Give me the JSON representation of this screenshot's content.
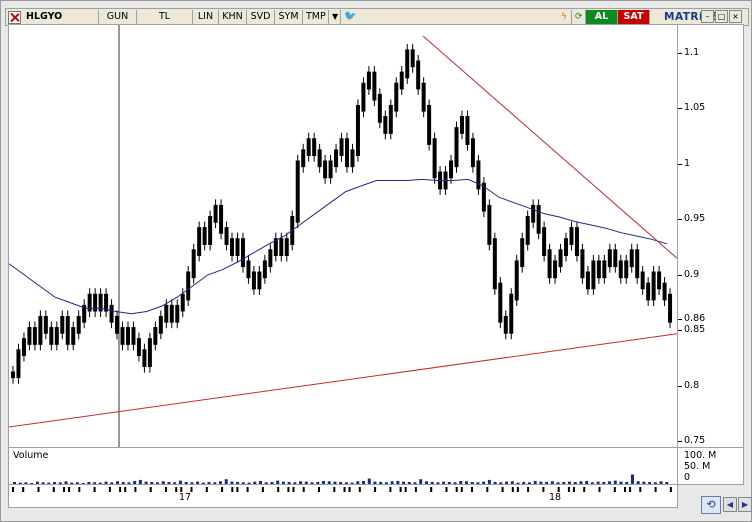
{
  "toolbar": {
    "symbol": "HLGYO",
    "period": "GUN",
    "currency": "TL",
    "scale": "LIN",
    "buttons": [
      "KHN",
      "SVD",
      "SYM",
      "TMP"
    ],
    "buy_label": "AL",
    "sell_label": "SAT",
    "brand": "MATRiKS"
  },
  "volume_panel": {
    "title": "Volume",
    "labels": [
      "100. M",
      "50. M",
      "0"
    ]
  },
  "chart_data": {
    "type": "candlestick",
    "y_ticks": [
      "1.1",
      "1.05",
      "1",
      "0.95",
      "0.9",
      "0.86",
      "0.85",
      "0.8",
      "0.75"
    ],
    "ylim": [
      0.745,
      1.125
    ],
    "x_labels": [
      "17",
      "18"
    ],
    "series": [
      {
        "name": "price",
        "values": [
          0.81,
          0.83,
          0.84,
          0.85,
          0.84,
          0.86,
          0.85,
          0.84,
          0.85,
          0.86,
          0.84,
          0.85,
          0.86,
          0.87,
          0.88,
          0.87,
          0.88,
          0.87,
          0.86,
          0.85,
          0.84,
          0.85,
          0.84,
          0.83,
          0.82,
          0.84,
          0.85,
          0.86,
          0.87,
          0.86,
          0.87,
          0.88,
          0.9,
          0.92,
          0.94,
          0.93,
          0.95,
          0.96,
          0.94,
          0.93,
          0.92,
          0.93,
          0.91,
          0.9,
          0.89,
          0.9,
          0.91,
          0.92,
          0.93,
          0.92,
          0.93,
          0.95,
          1.0,
          1.01,
          1.02,
          1.01,
          1.0,
          0.99,
          1.0,
          1.01,
          1.02,
          1.0,
          1.01,
          1.05,
          1.07,
          1.08,
          1.06,
          1.04,
          1.03,
          1.05,
          1.07,
          1.08,
          1.1,
          1.09,
          1.07,
          1.05,
          1.02,
          0.99,
          0.98,
          0.99,
          1.0,
          1.03,
          1.04,
          1.02,
          1.0,
          0.98,
          0.96,
          0.93,
          0.89,
          0.86,
          0.85,
          0.88,
          0.91,
          0.93,
          0.95,
          0.96,
          0.94,
          0.92,
          0.9,
          0.91,
          0.92,
          0.93,
          0.94,
          0.92,
          0.9,
          0.89,
          0.91,
          0.9,
          0.91,
          0.92,
          0.91,
          0.9,
          0.91,
          0.92,
          0.9,
          0.89,
          0.88,
          0.9,
          0.89,
          0.88,
          0.86
        ]
      },
      {
        "name": "moving-average",
        "values": [
          0.91,
          0.9,
          0.89,
          0.88,
          0.875,
          0.87,
          0.87,
          0.867,
          0.865,
          0.867,
          0.872,
          0.88,
          0.89,
          0.9,
          0.905,
          0.912,
          0.92,
          0.928,
          0.935,
          0.945,
          0.955,
          0.965,
          0.975,
          0.98,
          0.985,
          0.985,
          0.985,
          0.986,
          0.985,
          0.985,
          0.986,
          0.98,
          0.97,
          0.965,
          0.96,
          0.955,
          0.952,
          0.948,
          0.945,
          0.942,
          0.938,
          0.935,
          0.932,
          0.928
        ]
      }
    ],
    "trendlines": [
      {
        "name": "support",
        "from": [
          0,
          0.763
        ],
        "to": [
          1,
          0.847
        ],
        "color": "#cc2a2a"
      },
      {
        "name": "resistance",
        "from": [
          0.62,
          1.115
        ],
        "to": [
          1,
          0.915
        ],
        "color": "#cc2a2a"
      }
    ],
    "volume": [
      6,
      4,
      5,
      3,
      7,
      5,
      4,
      6,
      5,
      8,
      4,
      5,
      3,
      6,
      5,
      4,
      7,
      5,
      8,
      6,
      5,
      9,
      12,
      7,
      6,
      5,
      8,
      6,
      5,
      10,
      6,
      5,
      7,
      4,
      6,
      5,
      8,
      14,
      7,
      6,
      5,
      4,
      7,
      9,
      5,
      6,
      10,
      7,
      6,
      5,
      8,
      7,
      5,
      6,
      9,
      8,
      7,
      6,
      5,
      4,
      8,
      9,
      16,
      7,
      6,
      5,
      8,
      9,
      7,
      6,
      5,
      14,
      8,
      6,
      5,
      7,
      6,
      5,
      9,
      8,
      6,
      5,
      7,
      12,
      6,
      5,
      7,
      8,
      4,
      6,
      5,
      9,
      7,
      6,
      8,
      5,
      6,
      7,
      6,
      8,
      9,
      5,
      7,
      6,
      8,
      10,
      7,
      6,
      28,
      8,
      7,
      6,
      5,
      8,
      6
    ],
    "colors": {
      "price": "#000000",
      "moving_average": "#1a2a8a",
      "trendline": "#cc2a2a",
      "cursor": "#333333"
    }
  }
}
